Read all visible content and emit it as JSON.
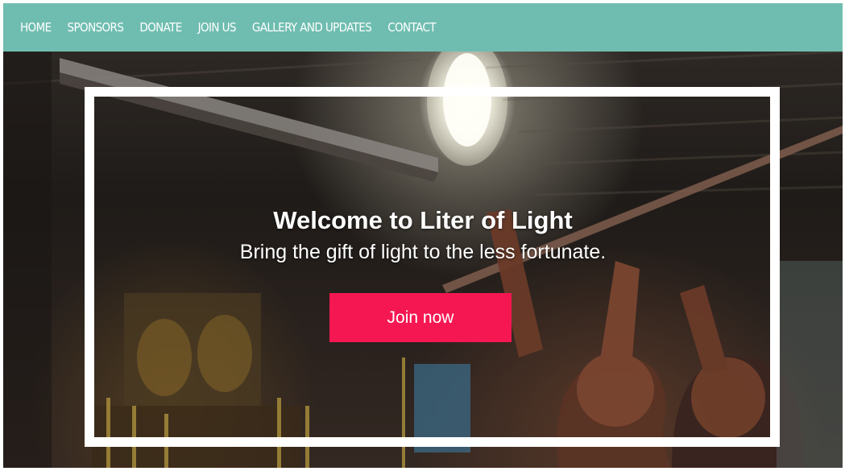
{
  "nav": {
    "items": [
      {
        "label": "HOME"
      },
      {
        "label": "SPONSORS"
      },
      {
        "label": "DONATE"
      },
      {
        "label": "JOIN US"
      },
      {
        "label": "GALLERY AND UPDATES"
      },
      {
        "label": "CONTACT"
      }
    ]
  },
  "hero": {
    "title": "Welcome to Liter of Light",
    "subtitle": "Bring the gift of light to the less fortunate.",
    "cta_label": "Join now"
  },
  "colors": {
    "navbar": "#6fbdb0",
    "cta": "#f51752",
    "frame": "#ffffff",
    "text": "#ffffff"
  }
}
